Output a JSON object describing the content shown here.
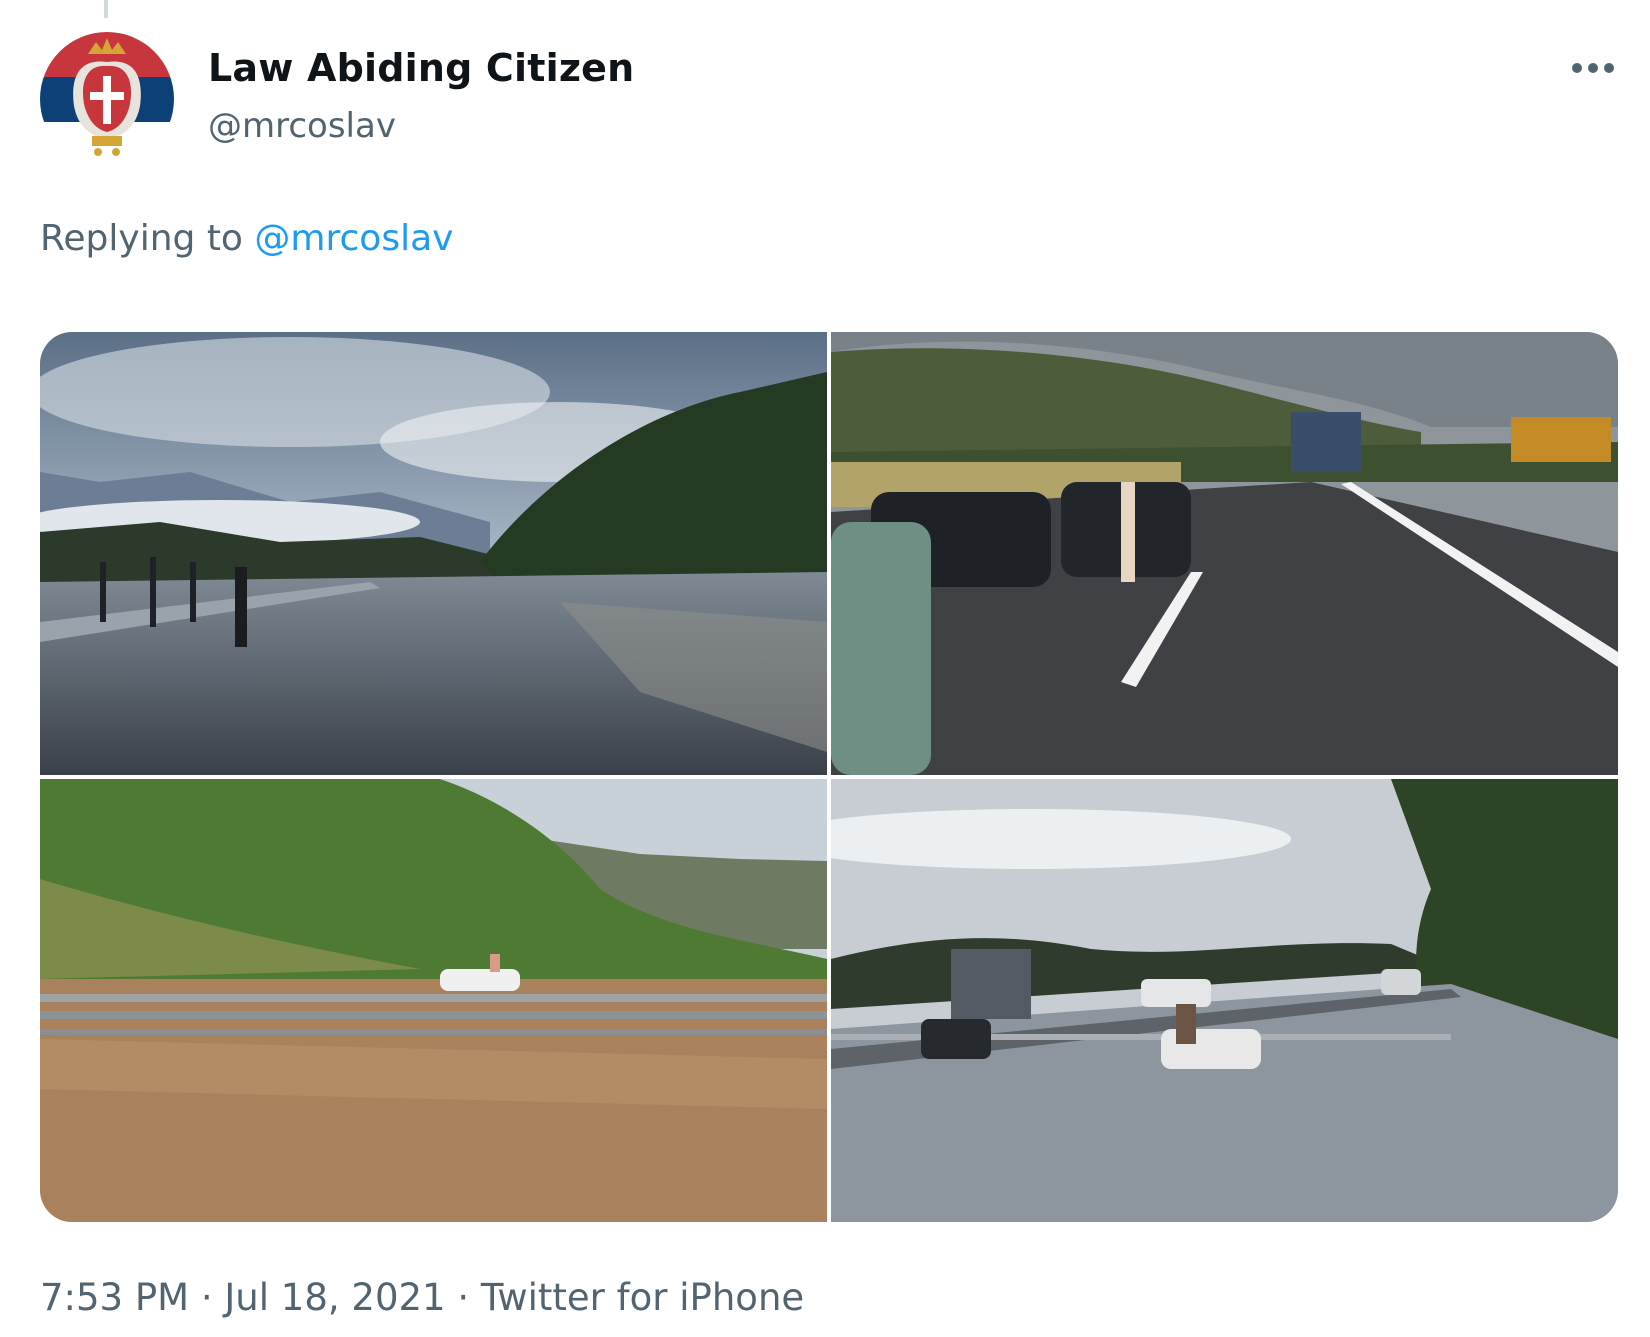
{
  "tweet": {
    "author": {
      "display_name": "Law Abiding Citizen",
      "handle": "@mrcoslav",
      "avatar_icon": "serbian-coat-of-arms-avatar"
    },
    "more_icon": "more-options-icon",
    "reply_context": {
      "prefix": "Replying to",
      "mention": "@mrcoslav"
    },
    "media": {
      "count": 4,
      "photos": [
        "flooded-highway-under-clouds",
        "stopped-traffic-on-highway",
        "car-submerged-in-muddy-floodwater",
        "cars-driving-through-flooded-road"
      ]
    },
    "meta": {
      "time": "7:53 PM",
      "separator": "·",
      "date": "Jul 18, 2021",
      "source": "Twitter for iPhone"
    }
  },
  "colors": {
    "text_primary": "#0f1419",
    "text_secondary": "#536471",
    "link": "#1d9bf0",
    "flag_red": "#c6363c",
    "flag_blue": "#0c4076"
  }
}
